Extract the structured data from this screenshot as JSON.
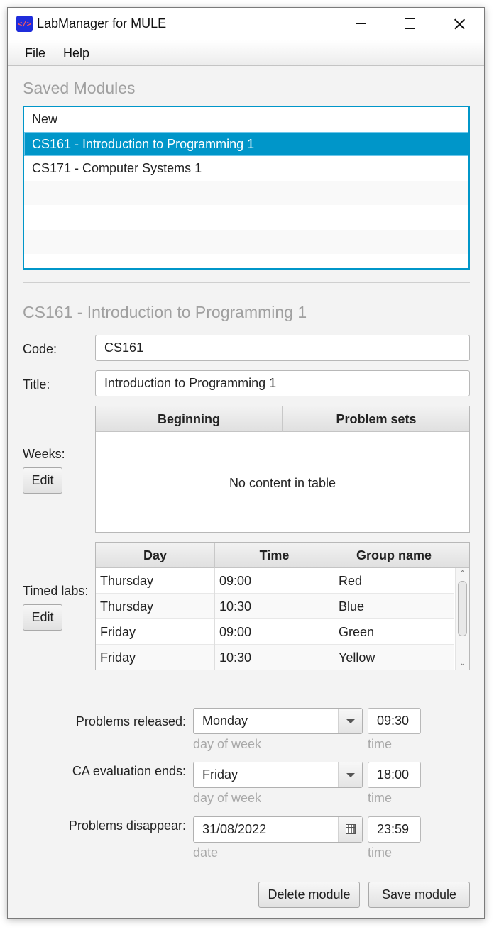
{
  "window": {
    "title": "LabManager for MULE",
    "icon_text": "</>"
  },
  "menu": {
    "file": "File",
    "help": "Help"
  },
  "saved_modules": {
    "heading": "Saved Modules",
    "items": [
      {
        "label": "New"
      },
      {
        "label": "CS161 - Introduction to Programming 1",
        "selected": true
      },
      {
        "label": "CS171 - Computer Systems 1"
      }
    ]
  },
  "module": {
    "heading": "CS161 - Introduction to Programming 1",
    "code_label": "Code:",
    "code_value": "CS161",
    "title_label": "Title:",
    "title_value": "Introduction to Programming 1",
    "weeks_label": "Weeks:",
    "weeks_edit": "Edit",
    "weeks_table": {
      "columns": [
        "Beginning",
        "Problem sets"
      ],
      "empty_message": "No content in table"
    },
    "timed_labs_label": "Timed labs:",
    "timed_labs_edit": "Edit",
    "timed_labs_table": {
      "columns": [
        "Day",
        "Time",
        "Group name"
      ],
      "rows": [
        [
          "Thursday",
          "09:00",
          "Red"
        ],
        [
          "Thursday",
          "10:30",
          "Blue"
        ],
        [
          "Friday",
          "09:00",
          "Green"
        ],
        [
          "Friday",
          "10:30",
          "Yellow"
        ]
      ]
    }
  },
  "schedule": {
    "problems_released": {
      "label": "Problems released:",
      "day": "Monday",
      "time": "09:30",
      "day_hint": "day of week",
      "time_hint": "time"
    },
    "ca_evaluation_ends": {
      "label": "CA evaluation ends:",
      "day": "Friday",
      "time": "18:00",
      "day_hint": "day of week",
      "time_hint": "time"
    },
    "problems_disappear": {
      "label": "Problems disappear:",
      "date": "31/08/2022",
      "time": "23:59",
      "date_hint": "date",
      "time_hint": "time"
    }
  },
  "actions": {
    "delete": "Delete module",
    "save": "Save module"
  },
  "colors": {
    "selection": "#0096c9",
    "window_bg": "#f3f3f3",
    "hint_text": "#a9a9a9"
  }
}
